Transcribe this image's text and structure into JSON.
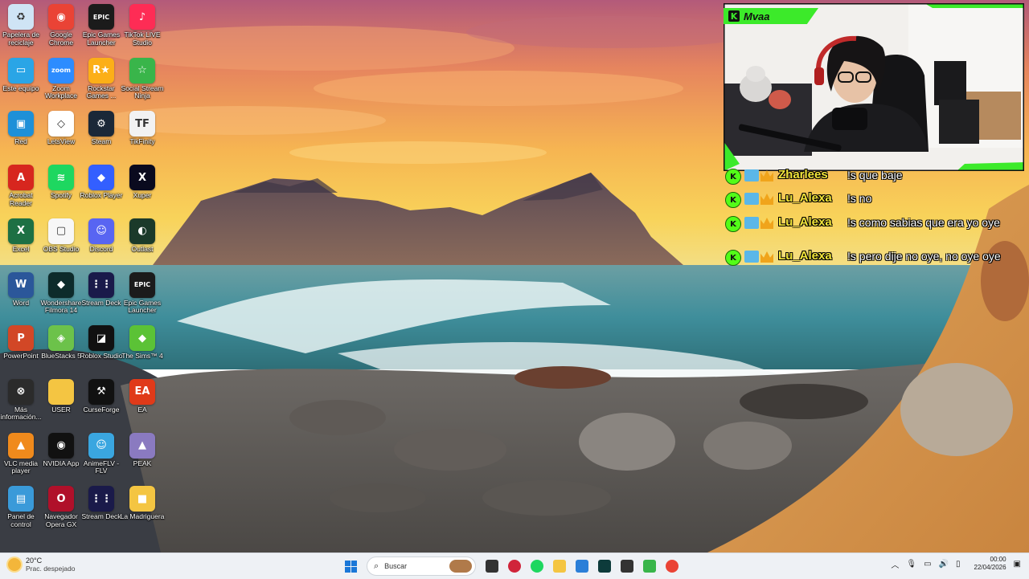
{
  "desktop_icons": [
    {
      "label": "Papelera de reciclaje",
      "icon": "recycle-bin-icon",
      "color": "#cfe4f5",
      "glyph": "♻"
    },
    {
      "label": "Google Chrome",
      "icon": "chrome-icon",
      "color": "#ea4335",
      "glyph": "◉"
    },
    {
      "label": "Epic Games Launcher",
      "icon": "epic-games-icon",
      "color": "#1b1b1b",
      "glyph": "EPIC"
    },
    {
      "label": "TikTok LIVE Studio",
      "icon": "tiktok-live-icon",
      "color": "#fe2c55",
      "glyph": "♪"
    },
    {
      "label": "Este equipo",
      "icon": "computer-icon",
      "color": "#2aa5e6",
      "glyph": "▭"
    },
    {
      "label": "Zoom Workplace",
      "icon": "zoom-icon",
      "color": "#2d8cff",
      "glyph": "zoom"
    },
    {
      "label": "Rockstar Games ...",
      "icon": "rockstar-icon",
      "color": "#fcaf17",
      "glyph": "R★"
    },
    {
      "label": "Social Stream Ninja",
      "icon": "social-stream-icon",
      "color": "#39b54a",
      "glyph": "☆"
    },
    {
      "label": "Red",
      "icon": "network-icon",
      "color": "#1e90d8",
      "glyph": "▣"
    },
    {
      "label": "LetsView",
      "icon": "letsview-icon",
      "color": "#ffffff",
      "glyph": "◇"
    },
    {
      "label": "Steam",
      "icon": "steam-icon",
      "color": "#1b2838",
      "glyph": "⚙"
    },
    {
      "label": "TikFinity",
      "icon": "tikfinity-icon",
      "color": "#f2f2f2",
      "glyph": "TF"
    },
    {
      "label": "Acrobat Reader",
      "icon": "acrobat-icon",
      "color": "#d7261e",
      "glyph": "A"
    },
    {
      "label": "Spotify",
      "icon": "spotify-icon",
      "color": "#1ed760",
      "glyph": "≋"
    },
    {
      "label": "Roblox Player",
      "icon": "roblox-player-icon",
      "color": "#335fff",
      "glyph": "◆"
    },
    {
      "label": "Xuper",
      "icon": "xuper-icon",
      "color": "#0a0a1e",
      "glyph": "X"
    },
    {
      "label": "Excel",
      "icon": "excel-icon",
      "color": "#1d7044",
      "glyph": "X"
    },
    {
      "label": "OBS Studio",
      "icon": "obs-icon",
      "color": "#f7f7f7",
      "glyph": "▢"
    },
    {
      "label": "Discord",
      "icon": "discord-icon",
      "color": "#5865f2",
      "glyph": "☺"
    },
    {
      "label": "Outlast",
      "icon": "outlast-icon",
      "color": "#1b3a2a",
      "glyph": "◐"
    },
    {
      "label": "Word",
      "icon": "word-icon",
      "color": "#2b579a",
      "glyph": "W"
    },
    {
      "label": "Wondershare Filmora 14",
      "icon": "filmora-icon",
      "color": "#0d2b2b",
      "glyph": "◆"
    },
    {
      "label": "Stream Deck",
      "icon": "stream-deck-icon",
      "color": "#1a1a4a",
      "glyph": "⋮⋮"
    },
    {
      "label": "Epic Games Launcher",
      "icon": "epic-games-icon-2",
      "color": "#1b1b1b",
      "glyph": "EPIC"
    },
    {
      "label": "PowerPoint",
      "icon": "powerpoint-icon",
      "color": "#d24726",
      "glyph": "P"
    },
    {
      "label": "BlueStacks 5",
      "icon": "bluestacks-icon",
      "color": "#6cc24a",
      "glyph": "◈"
    },
    {
      "label": "Roblox Studio",
      "icon": "roblox-studio-icon",
      "color": "#111111",
      "glyph": "◪"
    },
    {
      "label": "The Sims™ 4",
      "icon": "sims-icon",
      "color": "#5bc236",
      "glyph": "◆"
    },
    {
      "label": "Más información...",
      "icon": "info-icon",
      "color": "#2b2b2b",
      "glyph": "⊗"
    },
    {
      "label": "USER",
      "icon": "folder-icon",
      "color": "#f4c542",
      "glyph": ""
    },
    {
      "label": "CurseForge",
      "icon": "curseforge-icon",
      "color": "#111111",
      "glyph": "⚒"
    },
    {
      "label": "EA",
      "icon": "ea-icon",
      "color": "#e03a19",
      "glyph": "EA"
    },
    {
      "label": "VLC media player",
      "icon": "vlc-icon",
      "color": "#f08a1c",
      "glyph": "▲"
    },
    {
      "label": "NVIDIA App",
      "icon": "nvidia-icon",
      "color": "#111111",
      "glyph": "◉"
    },
    {
      "label": "AnimeFLV - FLV",
      "icon": "animeflv-icon",
      "color": "#3aa6e0",
      "glyph": "☺"
    },
    {
      "label": "PEAK",
      "icon": "peak-icon",
      "color": "#8a7ac0",
      "glyph": "▲"
    },
    {
      "label": "Panel de control",
      "icon": "control-panel-icon",
      "color": "#3a9ad9",
      "glyph": "▤"
    },
    {
      "label": "Navegador Opera GX",
      "icon": "opera-gx-icon",
      "color": "#b0102a",
      "glyph": "O"
    },
    {
      "label": "Stream Deck",
      "icon": "stream-deck-icon-2",
      "color": "#1a1a4a",
      "glyph": "⋮⋮"
    },
    {
      "label": "La Madriguera",
      "icon": "folder-icon-2",
      "color": "#f4c542",
      "glyph": "■"
    }
  ],
  "webcam": {
    "streamer_name": "Mvaa",
    "kick_glyph": "K",
    "accent": "#3cea2a"
  },
  "chat": [
    {
      "user": "Zharlees",
      "text": "!s que baje"
    },
    {
      "user": "Lu_Alexa",
      "text": "!s no"
    },
    {
      "user": "Lu_Alexa",
      "text": "!s como sabias que era yo oye"
    },
    {
      "user": "Lu_Alexa",
      "text": "!s pero dije no oye, no oye oye"
    }
  ],
  "taskbar": {
    "weather_temp": "20°C",
    "weather_desc": "Prac. despejado",
    "search_placeholder": "Buscar",
    "search_glyph": "⌕",
    "time": "00:00",
    "date": "22/04/2026",
    "tray_icons": [
      "chevron-up-icon",
      "microphone-icon",
      "network-icon",
      "volume-icon",
      "battery-icon",
      "notification-icon"
    ],
    "pinned_apps": [
      {
        "name": "task-view-icon",
        "color": "#333333"
      },
      {
        "name": "opera-gx-icon",
        "color": "#d0243a"
      },
      {
        "name": "spotify-icon",
        "color": "#1ed760"
      },
      {
        "name": "file-explorer-icon",
        "color": "#f4c542"
      },
      {
        "name": "microsoft-store-icon",
        "color": "#2b7fd8"
      },
      {
        "name": "filmora-icon",
        "color": "#0d3b3b"
      },
      {
        "name": "obs-icon",
        "color": "#333333"
      },
      {
        "name": "social-stream-icon",
        "color": "#39b54a"
      },
      {
        "name": "chrome-icon",
        "color": "#ea4335"
      }
    ]
  }
}
